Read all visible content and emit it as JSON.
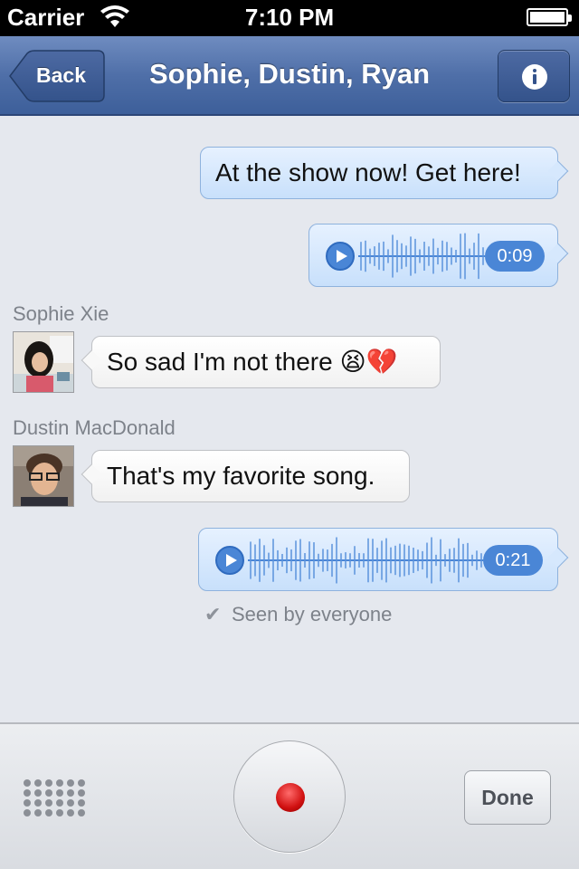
{
  "status_bar": {
    "carrier": "Carrier",
    "time": "7:10 PM",
    "wifi_icon": "wifi-icon",
    "battery_icon": "battery-icon"
  },
  "nav": {
    "back_label": "Back",
    "title": "Sophie, Dustin, Ryan",
    "info_icon": "info-icon"
  },
  "messages": [
    {
      "type": "text",
      "direction": "outgoing",
      "text": "At the show now! Get here!"
    },
    {
      "type": "voice",
      "direction": "outgoing",
      "duration": "0:09"
    },
    {
      "type": "text",
      "direction": "incoming",
      "sender": "Sophie Xie",
      "text": "So sad I'm not there 😫💔"
    },
    {
      "type": "text",
      "direction": "incoming",
      "sender": "Dustin MacDonald",
      "text": "That's my favorite song."
    },
    {
      "type": "voice",
      "direction": "outgoing",
      "duration": "0:21"
    }
  ],
  "seen": {
    "text": "Seen by everyone"
  },
  "toolbar": {
    "grid_icon": "keypad-grid-icon",
    "record_icon": "record-icon",
    "done_label": "Done"
  },
  "colors": {
    "nav_blue": "#4f6fa8",
    "outgoing_bubble": "#d6e8fd",
    "incoming_bubble": "#ffffff",
    "accent_blue": "#4a86d6",
    "record_red": "#d01010"
  }
}
